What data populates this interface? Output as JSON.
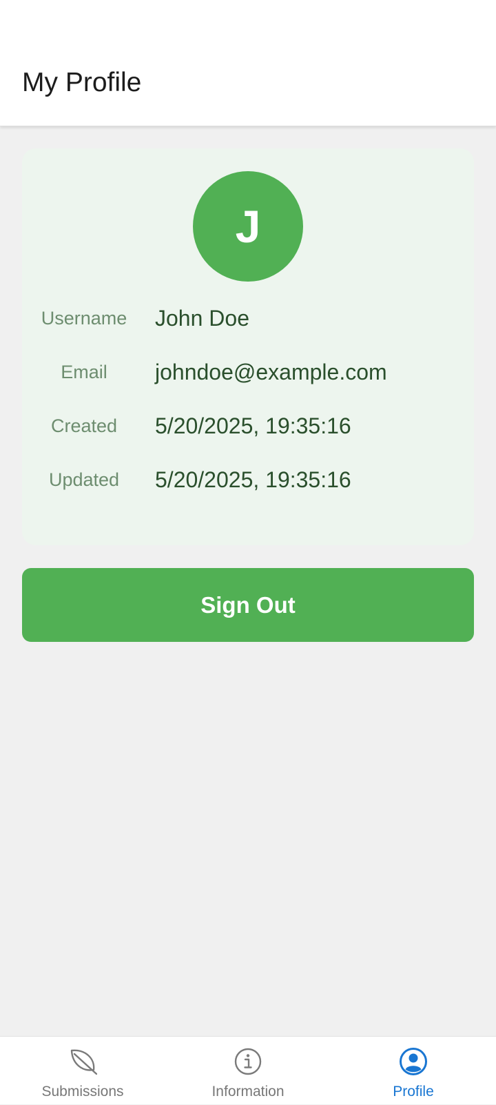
{
  "header": {
    "title": "My Profile"
  },
  "profile": {
    "avatar_initial": "J",
    "avatar_color": "#51b054",
    "fields": [
      {
        "label": "Username",
        "value": "John Doe"
      },
      {
        "label": "Email",
        "value": "johndoe@example.com"
      },
      {
        "label": "Created",
        "value": "5/20/2025, 19:35:16"
      },
      {
        "label": "Updated",
        "value": "5/20/2025, 19:35:16"
      }
    ]
  },
  "actions": {
    "sign_out_label": "Sign Out",
    "sign_out_color": "#51b054"
  },
  "bottom_nav": {
    "active_color": "#1976d2",
    "items": [
      {
        "label": "Submissions",
        "icon": "leaf-icon",
        "active": false
      },
      {
        "label": "Information",
        "icon": "info-icon",
        "active": false
      },
      {
        "label": "Profile",
        "icon": "account-circle-icon",
        "active": true
      }
    ]
  }
}
